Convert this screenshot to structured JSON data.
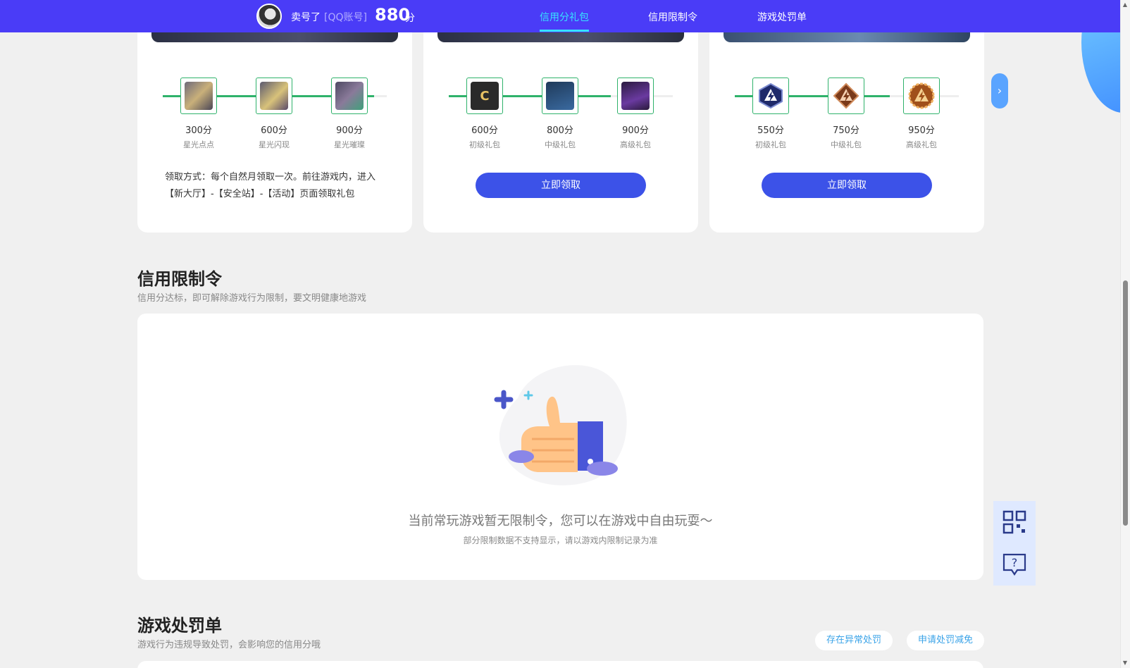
{
  "header": {
    "username": "卖号了",
    "account_tag": "[QQ账号]",
    "score": "880",
    "score_unit": "分",
    "nav": [
      "信用分礼包",
      "信用限制令",
      "游戏处罚单"
    ],
    "active_nav": "信用分礼包",
    "accent": "#4a3cf7",
    "active_color": "#37e2ff"
  },
  "gift_cards": [
    {
      "nodes": [
        {
          "points": "300分",
          "name": "星光点点"
        },
        {
          "points": "600分",
          "name": "星光闪现"
        },
        {
          "points": "900分",
          "name": "星光璀璨"
        }
      ],
      "progress": 1.0,
      "note": "领取方式：每个自然月领取一次。前往游戏内，进入【新大厅】-【安全站】-【活动】页面领取礼包"
    },
    {
      "nodes": [
        {
          "points": "600分",
          "name": "初级礼包"
        },
        {
          "points": "800分",
          "name": "中级礼包"
        },
        {
          "points": "900分",
          "name": "高级礼包"
        }
      ],
      "progress": 1.0,
      "button": "立即领取"
    },
    {
      "nodes": [
        {
          "points": "550分",
          "name": "初级礼包"
        },
        {
          "points": "750分",
          "name": "中级礼包"
        },
        {
          "points": "950分",
          "name": "高级礼包"
        }
      ],
      "progress": 1.0,
      "button": "立即领取"
    }
  ],
  "restriction": {
    "title": "信用限制令",
    "subtitle": "信用分达标，即可解除游戏行为限制，要文明健康地游戏",
    "empty_main": "当前常玩游戏暂无限制令，您可以在游戏中自由玩耍～",
    "empty_sub": "部分限制数据不支持显示，请以游戏内限制记录为准"
  },
  "penalty": {
    "title": "游戏处罚单",
    "subtitle": "游戏行为违规导致处罚，会影响您的信用分哦",
    "pill_abnormal": "存在异常处罚",
    "pill_appeal": "申请处罚减免"
  },
  "icons": {
    "next": "chevron-right-icon",
    "qr": "qr-code-icon",
    "help": "help-chat-icon"
  }
}
